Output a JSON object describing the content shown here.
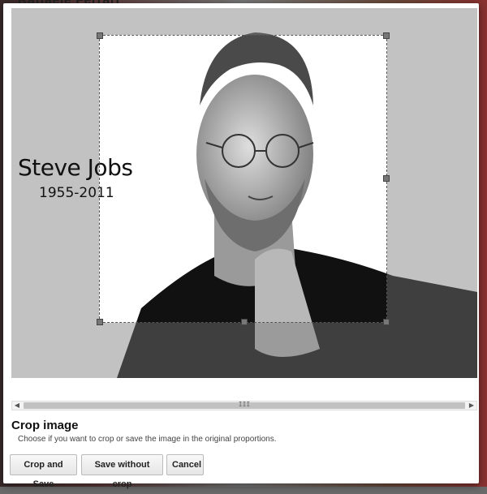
{
  "backdrop": {
    "partial_text": "Raffaele Ferrari"
  },
  "photo": {
    "title": "Steve Jobs",
    "years": "1955-2011"
  },
  "scrollbar": {
    "left_arrow": "◀",
    "right_arrow": "▶",
    "grip": "III"
  },
  "dialog": {
    "title": "Crop image",
    "description": "Choose if you want to crop or save the image in the original proportions."
  },
  "buttons": {
    "crop_and_save": "Crop and Save",
    "save_without_crop": "Save without crop",
    "cancel": "Cancel"
  },
  "colors": {
    "dialog_background": "#ffffff",
    "viewport_background": "#8f8f8f",
    "button_border": "#bbbbbb"
  }
}
